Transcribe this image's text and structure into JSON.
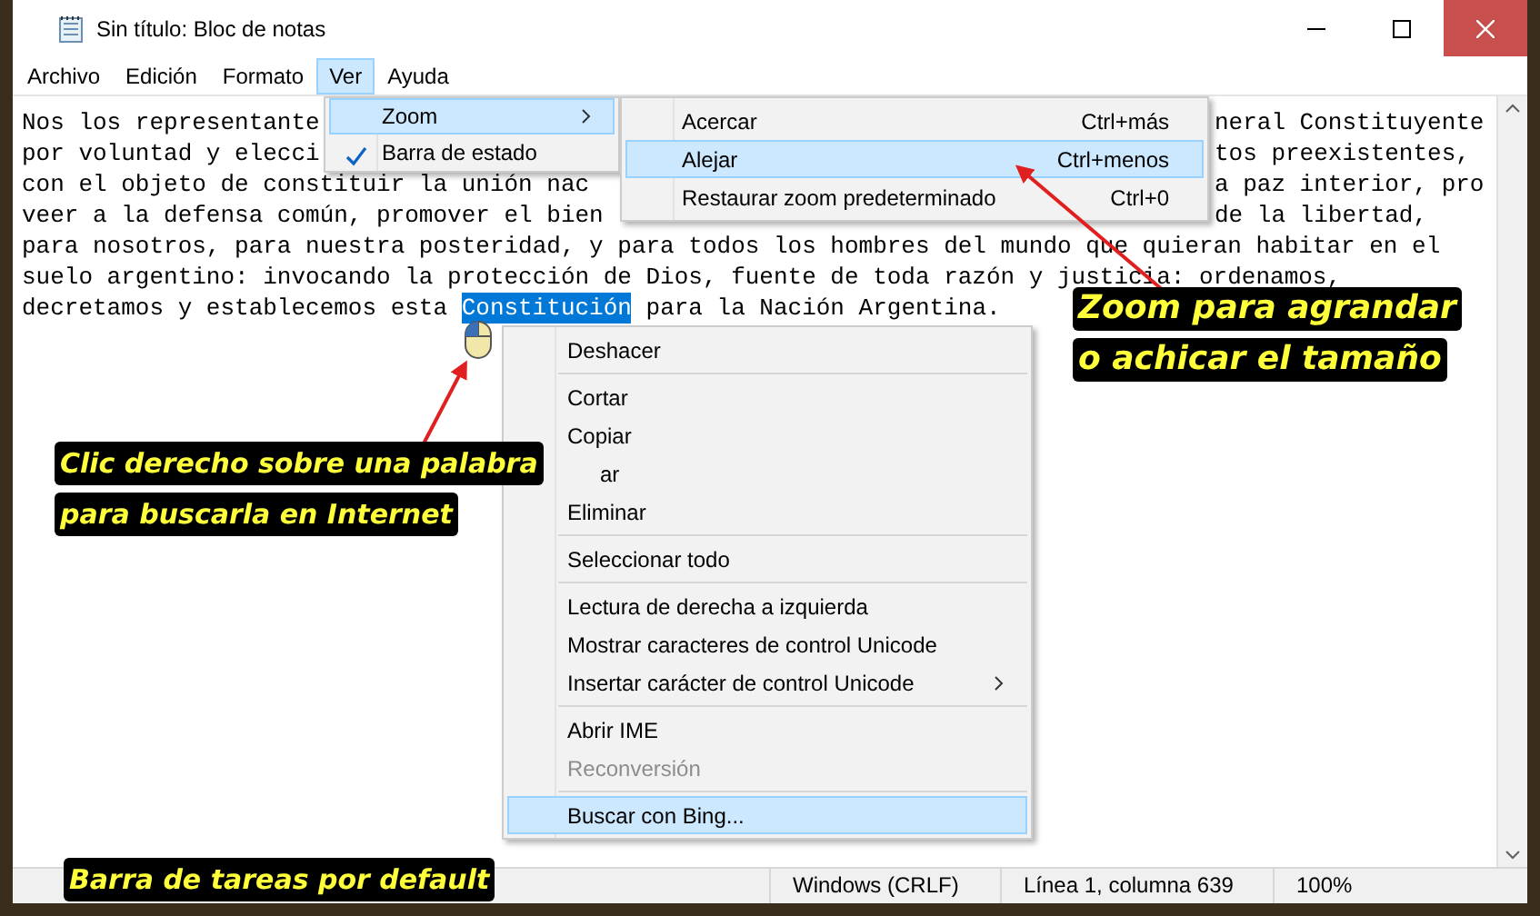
{
  "window": {
    "title": "Sin título: Bloc de notas"
  },
  "menu_bar": [
    {
      "label": "Archivo",
      "selected": false
    },
    {
      "label": "Edición",
      "selected": false
    },
    {
      "label": "Formato",
      "selected": false
    },
    {
      "label": "Ver",
      "selected": true
    },
    {
      "label": "Ayuda",
      "selected": false
    }
  ],
  "editor": {
    "lines": [
      {
        "segments": [
          {
            "kind": "before_menu",
            "text": "Nos los representante",
            "selected": false
          },
          {
            "kind": "text",
            "text": "neral Constituyente",
            "selected": false
          }
        ]
      },
      {
        "segments": [
          {
            "kind": "before_menu",
            "text": "por voluntad y elecci",
            "selected": false
          },
          {
            "kind": "text",
            "text": "tos preexistentes,",
            "selected": false
          }
        ]
      },
      {
        "segments": [
          {
            "kind": "before_menu",
            "text": "con el objeto de constituir la unión nac",
            "selected": false
          },
          {
            "kind": "text",
            "text": "a paz interior, pro",
            "selected": false
          }
        ]
      },
      {
        "segments": [
          {
            "kind": "before_menu",
            "text": "veer a la defensa común, promover el bien",
            "selected": false
          },
          {
            "kind": "text",
            "text": "de la libertad,",
            "selected": false
          }
        ]
      },
      {
        "segments": [
          {
            "kind": "text",
            "text": "para nosotros, para nuestra posteridad, y para todos los hombres del mundo que quieran habitar en el",
            "selected": false
          }
        ]
      },
      {
        "segments": [
          {
            "kind": "text",
            "text": "suelo argentino: invocando la protección de Dios, fuente de toda razón y justicia: ordenamos,",
            "selected": false
          }
        ]
      },
      {
        "segments": [
          {
            "kind": "text",
            "text": "decretamos y establecemos esta ",
            "selected": false
          },
          {
            "kind": "text",
            "text": "Constitución",
            "selected": true
          },
          {
            "kind": "text",
            "text": " para la Nación Argentina.",
            "selected": false
          }
        ]
      }
    ]
  },
  "view_menu": {
    "items": [
      {
        "label": "Zoom",
        "selected": true,
        "checked": false,
        "submenu": true
      },
      {
        "label": "Barra de estado",
        "selected": false,
        "checked": true,
        "submenu": false
      }
    ]
  },
  "zoom_submenu": {
    "items": [
      {
        "label": "Acercar",
        "shortcut": "Ctrl+más",
        "selected": false
      },
      {
        "label": "Alejar",
        "shortcut": "Ctrl+menos",
        "selected": true
      },
      {
        "label": "Restaurar zoom predeterminado",
        "shortcut": "Ctrl+0",
        "selected": false
      }
    ]
  },
  "context_menu": {
    "items": [
      {
        "kind": "item",
        "label": "Deshacer",
        "disabled": false,
        "selected": false,
        "submenu": false
      },
      {
        "kind": "separator"
      },
      {
        "kind": "item",
        "label": "Cortar",
        "disabled": false,
        "selected": false,
        "submenu": false
      },
      {
        "kind": "item",
        "label": "Copiar",
        "disabled": false,
        "selected": false,
        "submenu": false
      },
      {
        "kind": "partial",
        "label": "ar",
        "disabled": false,
        "selected": false,
        "submenu": false
      },
      {
        "kind": "item",
        "label": "Eliminar",
        "disabled": false,
        "selected": false,
        "submenu": false
      },
      {
        "kind": "separator"
      },
      {
        "kind": "item",
        "label": "Seleccionar todo",
        "disabled": false,
        "selected": false,
        "submenu": false
      },
      {
        "kind": "separator"
      },
      {
        "kind": "item",
        "label": "Lectura de derecha a izquierda",
        "disabled": false,
        "selected": false,
        "submenu": false
      },
      {
        "kind": "item",
        "label": "Mostrar caracteres de control Unicode",
        "disabled": false,
        "selected": false,
        "submenu": false
      },
      {
        "kind": "item",
        "label": "Insertar carácter de control Unicode",
        "disabled": false,
        "selected": false,
        "submenu": true
      },
      {
        "kind": "separator"
      },
      {
        "kind": "item",
        "label": "Abrir IME",
        "disabled": false,
        "selected": false,
        "submenu": false
      },
      {
        "kind": "item",
        "label": "Reconversión",
        "disabled": true,
        "selected": false,
        "submenu": false
      },
      {
        "kind": "separator"
      },
      {
        "kind": "item",
        "label": "Buscar con Bing...",
        "disabled": false,
        "selected": true,
        "submenu": false
      }
    ]
  },
  "status_bar": [
    "Windows (CRLF)",
    "Línea 1, columna 639",
    "100%"
  ],
  "annotations": [
    {
      "lines": [
        "Zoom para agrandar",
        "o achicar el tamaño"
      ]
    },
    {
      "lines": [
        "Clic derecho sobre una palabra",
        "para buscarla en Internet"
      ]
    },
    {
      "lines": [
        "Barra de tareas por default"
      ]
    }
  ]
}
